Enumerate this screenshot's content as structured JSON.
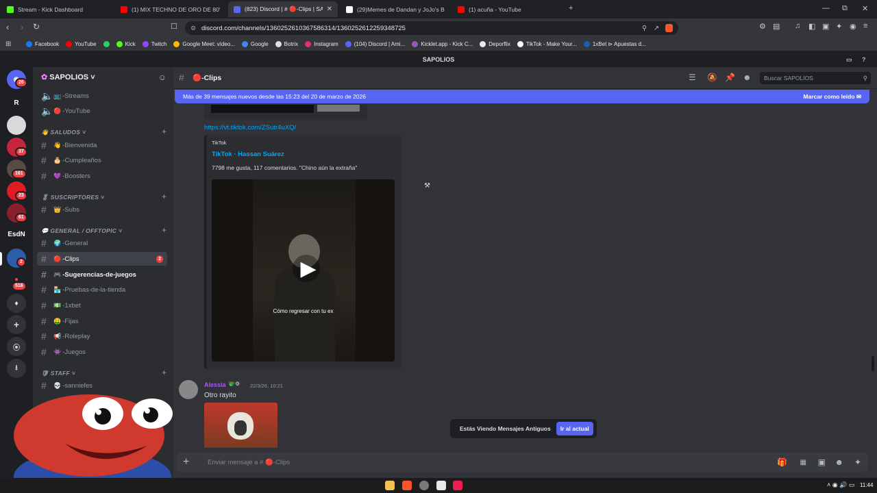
{
  "tabs": [
    {
      "title": "Stream - Kick Dashboard",
      "favicon": "kick-icon",
      "color": "#53fc18",
      "active": false
    },
    {
      "title": "(1) MIX TECHNO DE ORO DE 80's &",
      "favicon": "youtube-icon",
      "color": "#ff0000",
      "active": false
    },
    {
      "title": "(823) Discord | # 🔴-Clips | SAPOL",
      "favicon": "discord-icon",
      "color": "#5865f2",
      "active": true
    },
    {
      "title": "(29)Memes de Dandan y JoJo's Bizarr",
      "favicon": "tiktok-icon",
      "color": "#ffffff",
      "active": false
    },
    {
      "title": "(1) acuña - YouTube",
      "favicon": "youtube-icon",
      "color": "#ff0000",
      "active": false
    }
  ],
  "address": {
    "url": "discord.com/channels/1360252610367586314/1360252612259348725"
  },
  "bookmarks": [
    {
      "label": "Facebook",
      "color": "#1877f2"
    },
    {
      "label": "YouTube",
      "color": "#ff0000"
    },
    {
      "label": "",
      "color": "#25d366"
    },
    {
      "label": "Kick",
      "color": "#53fc18"
    },
    {
      "label": "Twitch",
      "color": "#9146ff"
    },
    {
      "label": "Google Meet: vídeo...",
      "color": "#ffba00"
    },
    {
      "label": "Google",
      "color": "#4285f4"
    },
    {
      "label": "Botrix",
      "color": "#e0e0e0"
    },
    {
      "label": "Instagram",
      "color": "#e1306c"
    },
    {
      "label": "(104) Discord | Ami...",
      "color": "#5865f2"
    },
    {
      "label": "Kicklet.app - Kick C...",
      "color": "#9b59b6"
    },
    {
      "label": "Deporflix",
      "color": "#e8eaed"
    },
    {
      "label": "TikTok - Make Your...",
      "color": "#ffffff"
    },
    {
      "label": "1xBet ⊳ Apuestas d...",
      "color": "#1a5fb4"
    }
  ],
  "app_title": "SAPOLIOS",
  "rail": {
    "badges": [
      "26",
      "37",
      "161",
      "23",
      "61",
      "2",
      "516"
    ],
    "labels": [
      "R",
      "EsdN"
    ]
  },
  "server": {
    "name": "SAPOLIOS"
  },
  "channels": {
    "top": [
      {
        "name": "-Streams",
        "emoji": "📺"
      },
      {
        "name": "-YouTube",
        "emoji": "🔴"
      }
    ],
    "cat_saludos": "👋 SALUDOS",
    "saludos": [
      {
        "name": "-Bienvenida",
        "emoji": "👋"
      },
      {
        "name": "-Cumpleaños",
        "emoji": "🎂"
      },
      {
        "name": "-Boosters",
        "emoji": "💜"
      }
    ],
    "cat_suscriptores": "🎖 SUSCRIPTORES",
    "suscriptores": [
      {
        "name": "-Subs",
        "emoji": "👑"
      }
    ],
    "cat_general": "💬 GENERAL / OFFTOPIC",
    "general": [
      {
        "name": "-General",
        "emoji": "🌍"
      },
      {
        "name": "-Clips",
        "emoji": "🔴",
        "badge": "2"
      },
      {
        "name": "-Sugerencias-de-juegos",
        "emoji": "🎮"
      },
      {
        "name": "-Pruebas-de-la-tienda",
        "emoji": "🏪"
      },
      {
        "name": "-1xbet",
        "emoji": "💵"
      },
      {
        "name": "-Fijas",
        "emoji": "🤑"
      },
      {
        "name": "-Roleplay",
        "emoji": "📢"
      },
      {
        "name": "-Juegos",
        "emoji": "👾"
      }
    ],
    "cat_staff": "🛡 STAFF",
    "staff": [
      {
        "name": "-sanniefes",
        "emoji": "💀"
      }
    ]
  },
  "header": {
    "channel": "-Clips",
    "search_placeholder": "Buscar SAPOLIOS"
  },
  "new_messages": {
    "text": "Más de 39 mensajes nuevos desde las 15:23 del 20 de marzo de 2026",
    "mark_read": "Marcar como leído"
  },
  "messages": {
    "link": "https://vt.tiktok.com/ZSutr4uXQ/",
    "embed": {
      "provider": "TikTok",
      "title": "TikTok · Hassan Suárez",
      "desc": "7798 me gusta, 117 comentarios. \"Chino aún la extraña\"",
      "video_caption": "Cómo regresar con tu ex"
    },
    "second": {
      "author": "Alessia",
      "timestamp": "22/3/26, 10:21",
      "text": "Otro rayito"
    }
  },
  "old_messages": {
    "text": "Estás Viendo Mensajes Antiguos",
    "button": "Ir al actual"
  },
  "composer": {
    "placeholder": "Enviar mensaje a # 🔴-Clips"
  },
  "taskbar": {
    "time": "11:44"
  },
  "colors": {
    "blurple": "#5865f2",
    "red": "#f23f43",
    "link": "#00a8fc",
    "author": "#a855f7"
  }
}
